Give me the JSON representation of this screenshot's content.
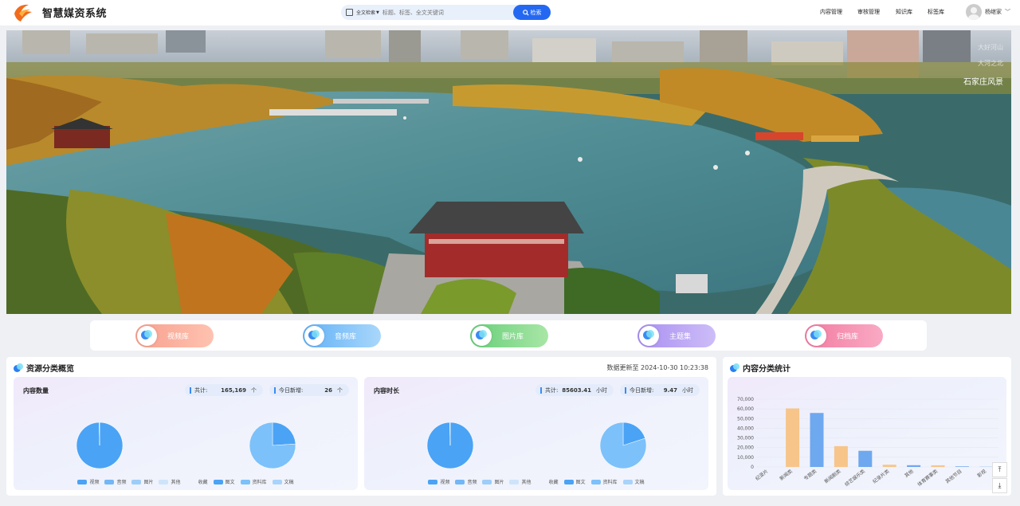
{
  "header": {
    "app_title": "智慧媒资系统",
    "search": {
      "type_label": "全文检索",
      "placeholder": "标题、标签、全文关键词",
      "button": "检索"
    },
    "nav": [
      "内容管理",
      "审核管理",
      "知识库",
      "标签库"
    ],
    "user": "杨继家"
  },
  "banner": {
    "captions": [
      "大好河山",
      "大河之北",
      "石家庄风景"
    ]
  },
  "libraries": [
    {
      "label": "视频库",
      "from": "#f7a08e",
      "to": "#ffc2b0"
    },
    {
      "label": "音频库",
      "from": "#62b1f6",
      "to": "#a9d7fb"
    },
    {
      "label": "图片库",
      "from": "#67cf7a",
      "to": "#a9e6a6"
    },
    {
      "label": "主题集",
      "from": "#a98ff1",
      "to": "#cdbdf8"
    },
    {
      "label": "归档库",
      "from": "#f27ba1",
      "to": "#f9aac4"
    }
  ],
  "overview": {
    "title": "资源分类概览",
    "updated": "数据更新至 2024-10-30 10:23:38",
    "count": {
      "title": "内容数量",
      "total_label": "共计:",
      "total": "165,169",
      "total_unit": "个",
      "today_label": "今日新增:",
      "today": "26",
      "today_unit": "个"
    },
    "duration": {
      "title": "内容时长",
      "total_label": "共计:",
      "total": "85603.41",
      "total_unit": "小时",
      "today_label": "今日新增:",
      "today": "9.47",
      "today_unit": "小时"
    },
    "legend_a": [
      "视频",
      "音频",
      "图片",
      "其他"
    ],
    "legend_b": [
      "收藏",
      "图文",
      "资料库",
      "文稿"
    ]
  },
  "colors": {
    "pie_dark": "#4aa3f5",
    "pie_light": "#7cc1fa",
    "bar_orange": "#f7c58a",
    "bar_blue": "#6ea8ef",
    "accent": "#2468f2"
  },
  "chart_data": [
    {
      "type": "pie",
      "values": [
        99.6,
        0.4
      ]
    },
    {
      "type": "pie",
      "values": [
        24,
        76
      ]
    },
    {
      "type": "pie",
      "values": [
        99.6,
        0.4
      ]
    },
    {
      "type": "pie",
      "values": [
        20,
        80
      ]
    },
    {
      "type": "bar",
      "title": "内容分类统计",
      "categories": [
        "纪录片",
        "新闻类",
        "专题类",
        "新闻剧类",
        "综艺娱乐类",
        "纪录片类",
        "其他",
        "体育赛事类",
        "其他节目",
        "影视"
      ],
      "values": [
        0,
        60500,
        55800,
        21500,
        16700,
        2300,
        1800,
        1700,
        600,
        200
      ],
      "colors": [
        "#f7c58a",
        "#f7c58a",
        "#6ea8ef",
        "#f7c58a",
        "#6ea8ef",
        "#f7c58a",
        "#6ea8ef",
        "#f7c58a",
        "#6ea8ef",
        "#6ea8ef"
      ],
      "yticks": [
        "70,000",
        "60,000",
        "50,000",
        "40,000",
        "30,000",
        "20,000",
        "10,000",
        "0"
      ],
      "ylim": [
        0,
        70000
      ]
    }
  ]
}
